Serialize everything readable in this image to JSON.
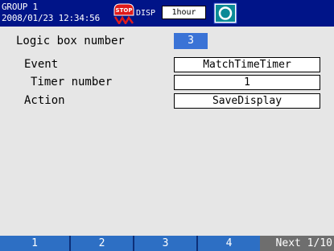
{
  "status_bar": {
    "group": "GROUP 1",
    "datetime": "2008/01/23 12:34:56",
    "stop_icon_text": "STOP",
    "disp_label": "DISP",
    "time_scale": "1hour"
  },
  "settings": {
    "logic_box_label": "Logic box number",
    "logic_box_value": "3",
    "event_label": "Event",
    "event_value": "MatchTimeTimer",
    "timer_label": "Timer number",
    "timer_value": "1",
    "action_label": "Action",
    "action_value": "SaveDisplay"
  },
  "softkeys": {
    "keys": [
      "1",
      "2",
      "3",
      "4"
    ],
    "next": "Next 1/10"
  },
  "colors": {
    "header_bg": "#001488",
    "selected_value": "#3a73d6",
    "softkey_bg": "#2d6fc4",
    "next_bg": "#6e6e6e"
  },
  "icons": {
    "stop": "stop-icon",
    "media": "media-status-icon"
  }
}
